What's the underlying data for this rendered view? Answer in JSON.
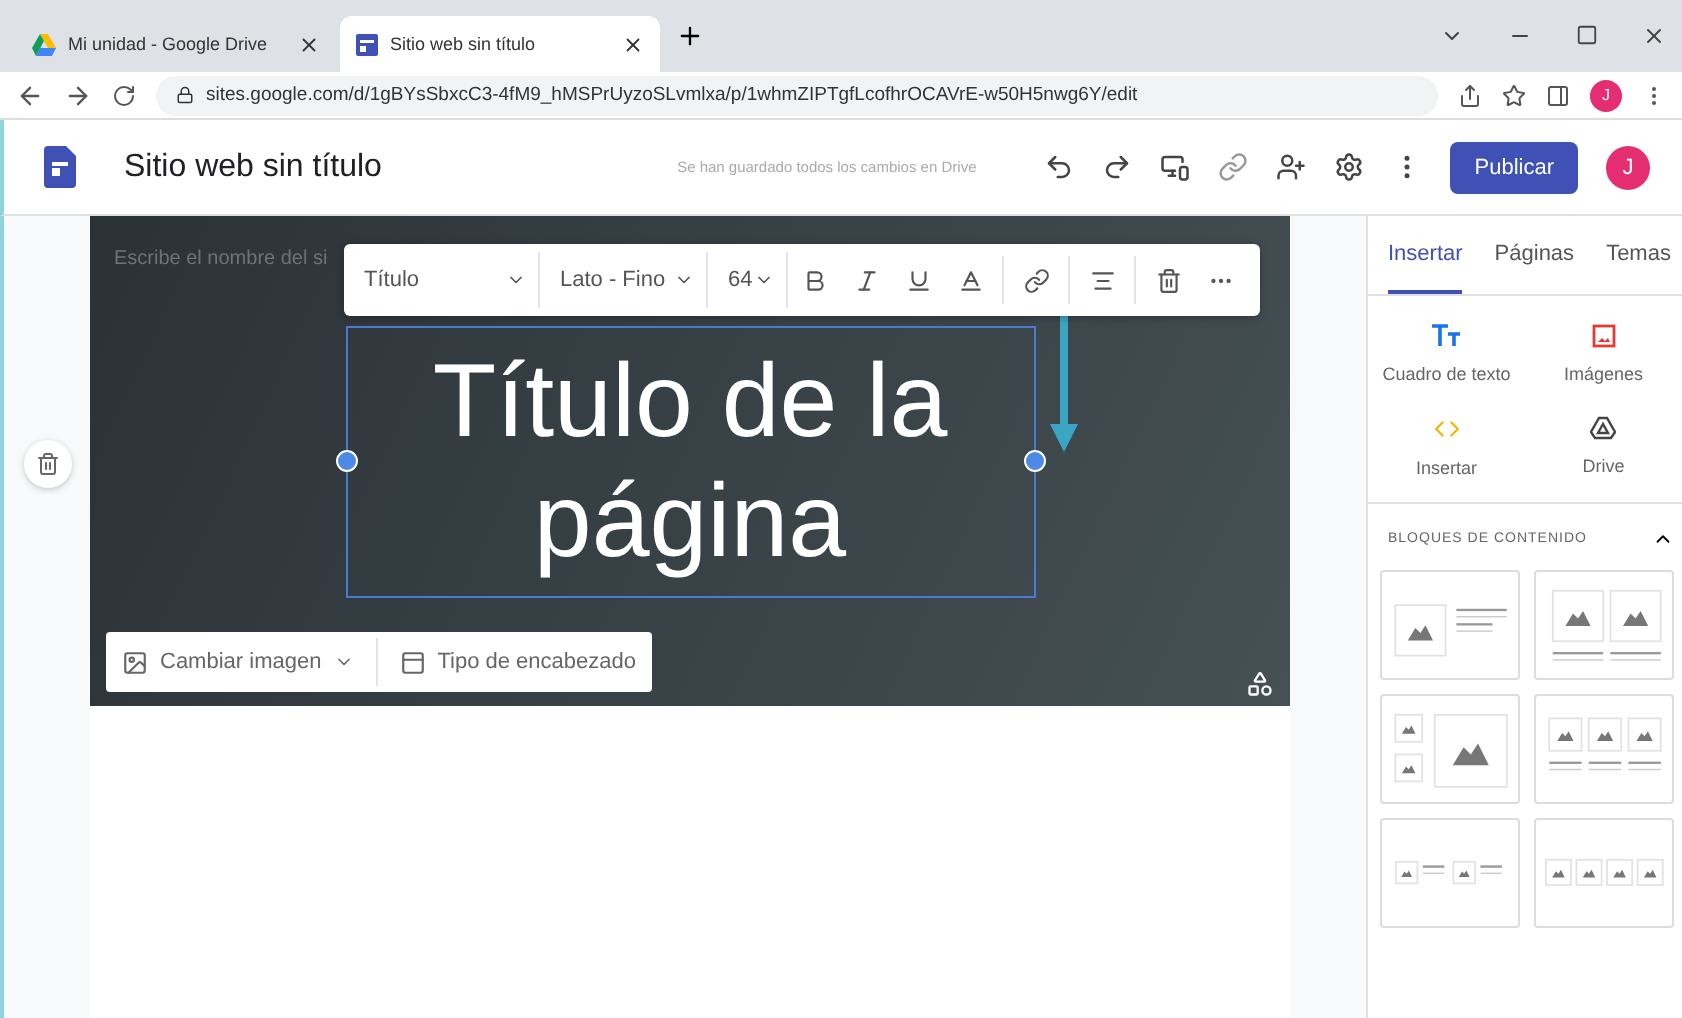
{
  "browser": {
    "tabs": [
      {
        "title": "Mi unidad - Google Drive",
        "kind": "drive",
        "selected": false
      },
      {
        "title": "Sitio web sin título",
        "kind": "sites",
        "selected": true
      }
    ],
    "url": "sites.google.com/d/1gBYsSbxcC3-4fM9_hMSPrUyzoSLvmlxa/p/1whmZIPTgfLcofhrOCAVrE-w50H5nwg6Y/edit",
    "avatar": "J"
  },
  "app": {
    "title": "Sitio web sin título",
    "save_status": "Se han guardado todos los cambios en Drive",
    "publish": "Publicar",
    "avatar": "J"
  },
  "editor": {
    "site_name_placeholder": "Escribe el nombre del si",
    "toolbar": {
      "style": "Título",
      "font": "Lato - Fino",
      "size": "64"
    },
    "page_title": "Título de la página",
    "header_buttons": [
      {
        "label": "Cambiar imagen",
        "kind": "image",
        "dropdown": true
      },
      {
        "label": "Tipo de encabezado",
        "kind": "layout",
        "dropdown": false
      }
    ]
  },
  "panel": {
    "tabs": [
      {
        "label": "Insertar",
        "selected": true
      },
      {
        "label": "Páginas",
        "selected": false
      },
      {
        "label": "Temas",
        "selected": false
      }
    ],
    "insert_items": [
      {
        "label": "Cuadro de texto",
        "kind": "text"
      },
      {
        "label": "Imágenes",
        "kind": "image"
      },
      {
        "label": "Insertar",
        "kind": "embed"
      },
      {
        "label": "Drive",
        "kind": "drive"
      }
    ],
    "section": {
      "title": "BLOQUES DE CONTENIDO",
      "expanded": true
    },
    "blocks": [
      {
        "kind": "image-text"
      },
      {
        "kind": "two-images"
      },
      {
        "kind": "collage"
      },
      {
        "kind": "three-images"
      },
      {
        "kind": "two-image-text"
      },
      {
        "kind": "four-images"
      }
    ]
  }
}
